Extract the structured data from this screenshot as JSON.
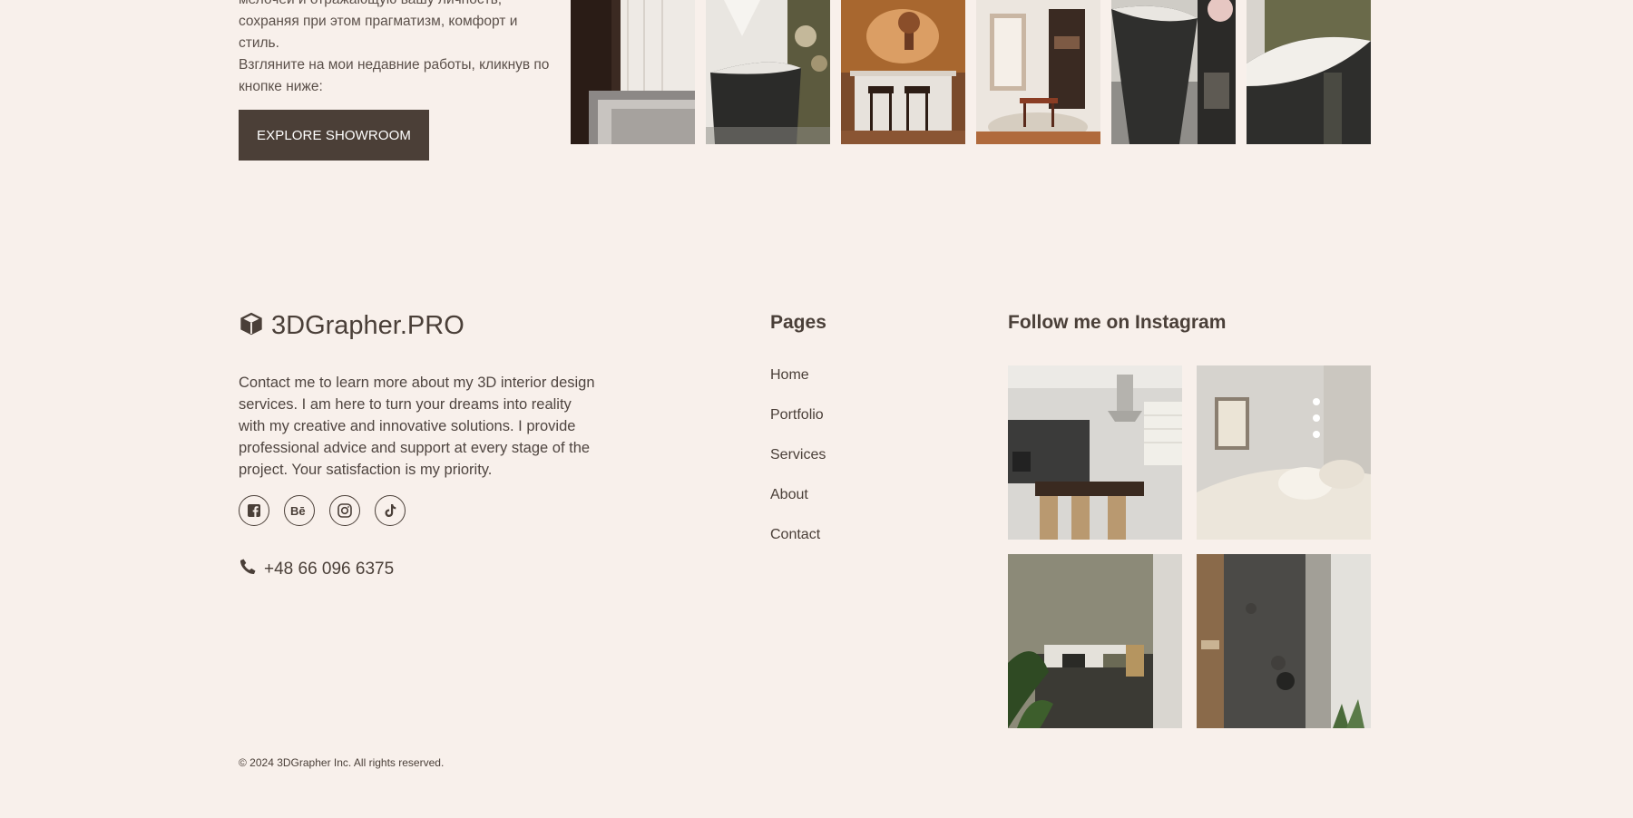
{
  "intro": {
    "text": "мелочей и отражающую вашу личность,\nсохраняя при этом прагматизм, комфорт и стиль.\nВзгляните на мои недавние работы, кликнув по\nкнопке ниже:",
    "cta_label": "EXPLORE SHOWROOM"
  },
  "showroom": {
    "images": [
      "bedroom-render",
      "black-bathtub-render",
      "kitchen-bar-render",
      "dining-room-render",
      "bathtub-render",
      "bathtub-closeup-render"
    ]
  },
  "footer": {
    "brand": "3DGrapher.PRO",
    "about": "Contact me to learn more about my 3D interior design services. I am here to turn your dreams into reality with my creative and innovative solutions. I provide professional advice and support at every stage of the project. Your satisfaction is my priority.",
    "socials": [
      "facebook-icon",
      "behance-icon",
      "instagram-icon",
      "tiktok-icon"
    ],
    "phone": "+48 66 096 6375",
    "pages_title": "Pages",
    "pages": [
      "Home",
      "Portfolio",
      "Services",
      "About",
      "Contact"
    ],
    "instagram_title": "Follow me on Instagram",
    "instagram_images": [
      "kitchen-dining-render",
      "bedroom-white-render",
      "bedroom-olive-render",
      "bathroom-stone-render"
    ],
    "copyright": "© 2024 3DGrapher Inc. All rights reserved."
  },
  "colors": {
    "background": "#f8f0eb",
    "button": "#4b3f37",
    "text": "#4a3f38"
  }
}
